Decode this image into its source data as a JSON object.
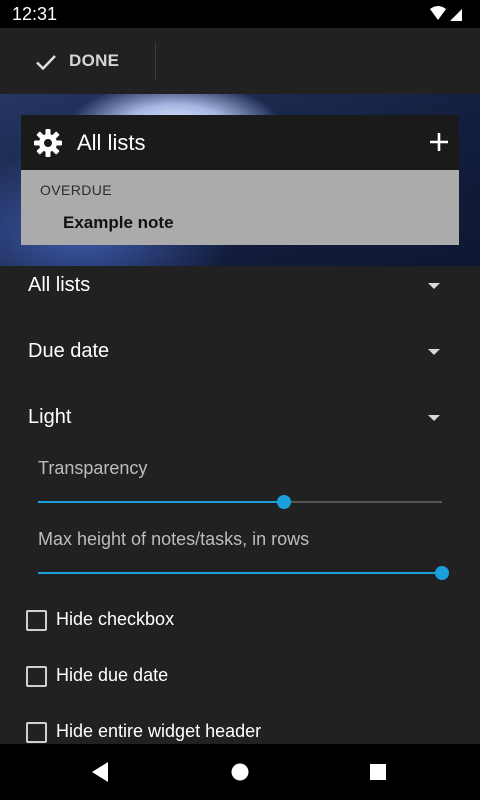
{
  "status_bar": {
    "time": "12:31",
    "icons": [
      "wifi-icon",
      "cell-signal-icon"
    ]
  },
  "action_bar": {
    "done_label": "DONE",
    "done_icon": "check-icon"
  },
  "widget_preview": {
    "title": "All lists",
    "settings_icon": "gear-icon",
    "add_icon": "plus-icon",
    "section_label": "OVERDUE",
    "note_title": "Example note"
  },
  "settings": {
    "list_dropdown": {
      "value": "All lists"
    },
    "sort_dropdown": {
      "value": "Due date"
    },
    "theme_dropdown": {
      "value": "Light"
    },
    "transparency": {
      "label": "Transparency",
      "value_fraction": 0.61
    },
    "max_height": {
      "label": "Max height of notes/tasks, in rows",
      "value_fraction": 1.0
    },
    "checkboxes": [
      {
        "label": "Hide checkbox",
        "checked": false
      },
      {
        "label": "Hide due date",
        "checked": false
      },
      {
        "label": "Hide entire widget header",
        "checked": false
      }
    ]
  },
  "nav_bar": {
    "back_icon": "back-triangle-icon",
    "home_icon": "home-circle-icon",
    "recents_icon": "recents-square-icon"
  },
  "colors": {
    "accent": "#1aa0dc",
    "background": "#212121",
    "widget_body": "#ababab"
  }
}
